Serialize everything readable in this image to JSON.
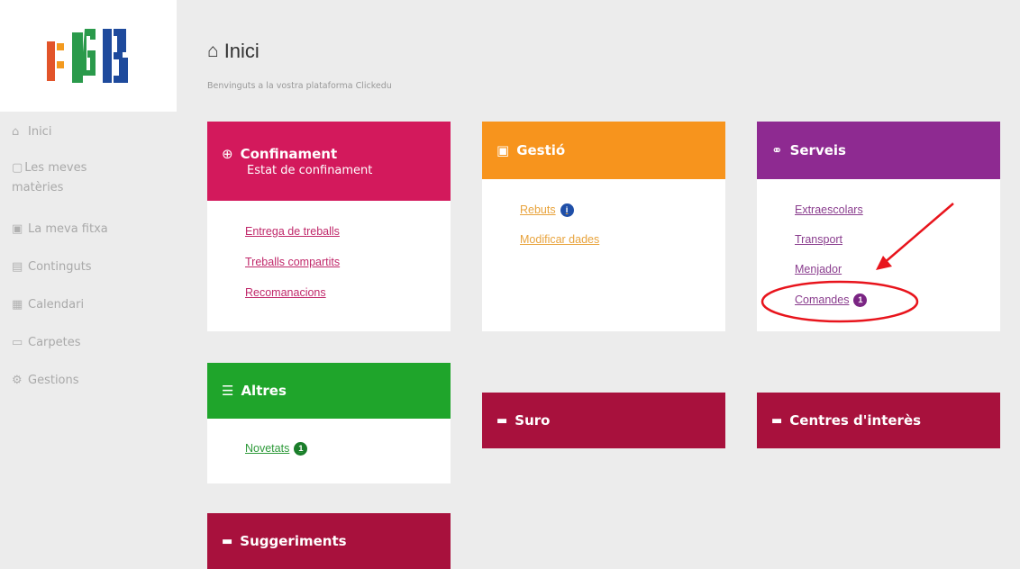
{
  "logo": {
    "text": "EGB"
  },
  "sidebar": {
    "items": [
      {
        "icon": "home-icon",
        "label": "Inici"
      },
      {
        "icon": "book-icon",
        "label": "Les meves matèries"
      },
      {
        "icon": "id-card-icon",
        "label": "La meva fitxa"
      },
      {
        "icon": "contents-icon",
        "label": "Continguts"
      },
      {
        "icon": "calendar-icon",
        "label": "Calendari"
      },
      {
        "icon": "folder-icon",
        "label": "Carpetes"
      },
      {
        "icon": "handshake-icon",
        "label": "Gestions"
      }
    ]
  },
  "header": {
    "title": "Inici",
    "subtitle": "Benvinguts a la vostra plataforma Clickedu"
  },
  "cards": {
    "confinament": {
      "title": "Confinament",
      "subtitle": "Estat de confinament",
      "links": [
        "Entrega de treballs",
        "Treballs compartits",
        "Recomanacions"
      ]
    },
    "gestio": {
      "title": "Gestió",
      "links": [
        {
          "label": "Rebuts",
          "badge": "i"
        },
        {
          "label": "Modificar dades"
        }
      ]
    },
    "serveis": {
      "title": "Serveis",
      "links": [
        {
          "label": "Extraescolars"
        },
        {
          "label": "Transport"
        },
        {
          "label": "Menjador"
        },
        {
          "label": "Comandes",
          "badge": "1"
        }
      ]
    },
    "altres": {
      "title": "Altres",
      "links": [
        {
          "label": "Novetats",
          "badge": "1"
        }
      ]
    }
  },
  "tiles": {
    "suro": "Suro",
    "centres": "Centres d'interès",
    "suggeriments": "Suggeriments"
  },
  "colors": {
    "confinament": "#d3195c",
    "gestio": "#f7941d",
    "serveis": "#8e2a91",
    "altres": "#1fa52b",
    "folder_tile": "#a8113d",
    "annotation": "#e8141c"
  }
}
